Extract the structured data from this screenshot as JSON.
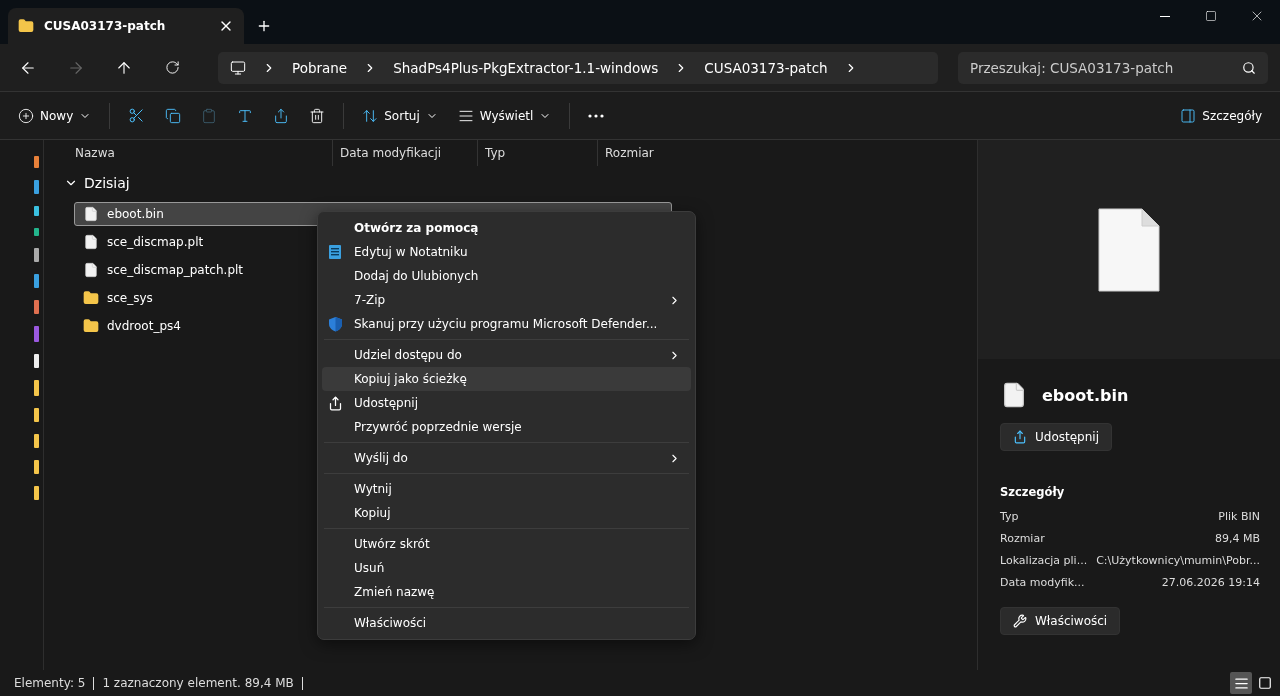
{
  "window": {
    "tab_title": "CUSA03173-patch"
  },
  "address": {
    "crumbs": [
      "Pobrane",
      "ShadPs4Plus-PkgExtractor-1.1-windows",
      "CUSA03173-patch"
    ]
  },
  "search": {
    "placeholder": "Przeszukaj: CUSA03173-patch"
  },
  "toolbar": {
    "new": "Nowy",
    "sort": "Sortuj",
    "view": "Wyświetl",
    "details": "Szczegóły"
  },
  "columns": [
    "Nazwa",
    "Data modyfikacji",
    "Typ",
    "Rozmiar"
  ],
  "group": {
    "label": "Dzisiaj",
    "expanded": true
  },
  "files": [
    {
      "name": "eboot.bin",
      "kind": "file",
      "selected": true
    },
    {
      "name": "sce_discmap.plt",
      "kind": "file",
      "selected": false
    },
    {
      "name": "sce_discmap_patch.plt",
      "kind": "file",
      "selected": false
    },
    {
      "name": "sce_sys",
      "kind": "folder",
      "selected": false
    },
    {
      "name": "dvdroot_ps4",
      "kind": "folder",
      "selected": false
    }
  ],
  "context_menu": [
    {
      "kind": "item",
      "label": "Otwórz za pomocą",
      "bold": true,
      "selected": false
    },
    {
      "kind": "notepad",
      "label": "Edytuj w Notatniku",
      "selected": false
    },
    {
      "kind": "item",
      "label": "Dodaj do Ulubionych",
      "selected": false
    },
    {
      "kind": "item",
      "label": "7-Zip",
      "submenu": true,
      "selected": false
    },
    {
      "kind": "defender",
      "label": "Skanuj przy użyciu programu Microsoft Defender...",
      "selected": false
    },
    {
      "kind": "separator"
    },
    {
      "kind": "item",
      "label": "Udziel dostępu do",
      "submenu": true,
      "selected": false
    },
    {
      "kind": "item",
      "label": "Kopiuj jako ścieżkę",
      "selected": true
    },
    {
      "kind": "share",
      "label": "Udostępnij",
      "selected": false
    },
    {
      "kind": "item",
      "label": "Przywróć poprzednie wersje",
      "selected": false
    },
    {
      "kind": "separator"
    },
    {
      "kind": "item",
      "label": "Wyślij do",
      "submenu": true,
      "selected": false
    },
    {
      "kind": "separator"
    },
    {
      "kind": "item",
      "label": "Wytnij",
      "selected": false
    },
    {
      "kind": "item",
      "label": "Kopiuj",
      "selected": false
    },
    {
      "kind": "separator"
    },
    {
      "kind": "item",
      "label": "Utwórz skrót",
      "selected": false
    },
    {
      "kind": "item",
      "label": "Usuń",
      "selected": false
    },
    {
      "kind": "item",
      "label": "Zmień nazwę",
      "selected": false
    },
    {
      "kind": "separator"
    },
    {
      "kind": "item",
      "label": "Właściwości",
      "selected": false
    }
  ],
  "details": {
    "name": "eboot.bin",
    "share": "Udostępnij",
    "heading": "Szczegóły",
    "props": [
      {
        "label": "Typ",
        "value": "Plik BIN"
      },
      {
        "label": "Rozmiar",
        "value": "89,4 MB"
      },
      {
        "label": "Lokalizacja pli...",
        "value": "C:\\Użytkownicy\\mumin\\Pobr..."
      },
      {
        "label": "Data modyfik...",
        "value": "27.06.2026 19:14"
      }
    ],
    "properties": "Właściwości"
  },
  "status_bar": {
    "count": "Elementy: 5",
    "selection": "1 zaznaczony element. 89,4 MB"
  },
  "views": [
    {
      "kind": "details",
      "selected": true
    },
    {
      "kind": "tiles",
      "selected": false
    }
  ]
}
